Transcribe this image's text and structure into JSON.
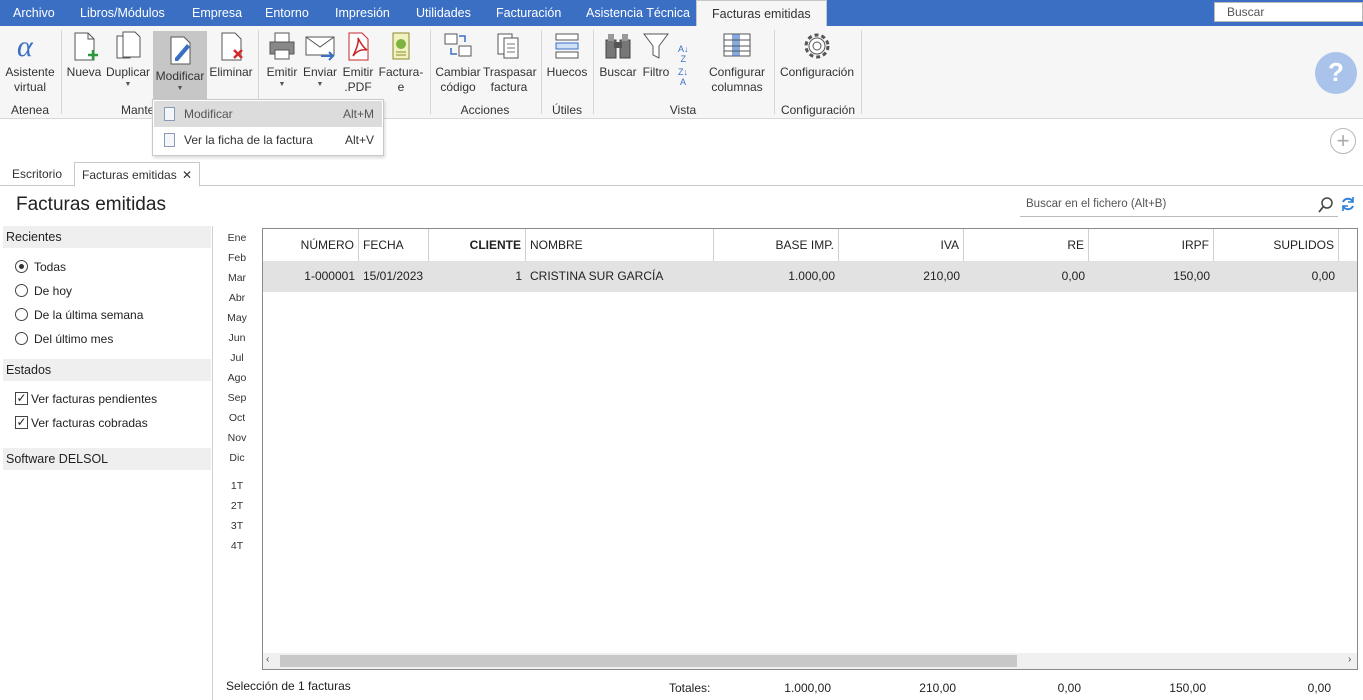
{
  "menubar": {
    "items": [
      "Archivo",
      "Libros/Módulos",
      "Empresa",
      "Entorno",
      "Impresión",
      "Utilidades",
      "Facturación",
      "Asistencia Técnica",
      "Facturas emitidas"
    ],
    "search_label": "Buscar"
  },
  "ribbon": {
    "buttons": {
      "asistente": "Asistente\nvirtual",
      "nueva": "Nueva",
      "duplicar": "Duplicar",
      "modificar": "Modificar",
      "eliminar": "Eliminar",
      "emitir": "Emitir",
      "enviar": "Enviar",
      "emitir_pdf": "Emitir\n.PDF",
      "factura_e": "Factura-\ne",
      "cambiar_codigo": "Cambiar\ncódigo",
      "traspasar": "Traspasar\nfactura",
      "huecos": "Huecos",
      "buscar": "Buscar",
      "filtro": "Filtro",
      "configurar_columnas": "Configurar\ncolumnas",
      "configuracion": "Configuración"
    },
    "groups": {
      "atenea": "Atenea",
      "mantenimiento": "Mante",
      "acciones": "Acciones",
      "utiles": "Útiles",
      "vista": "Vista",
      "configuracion": "Configuración"
    }
  },
  "dropdown": {
    "items": [
      {
        "label": "Modificar",
        "shortcut": "Alt+M"
      },
      {
        "label": "Ver la ficha de la factura",
        "shortcut": "Alt+V"
      }
    ]
  },
  "tabs": {
    "escritorio": "Escritorio",
    "facturas": "Facturas emitidas",
    "close": "✕"
  },
  "page": {
    "title": "Facturas emitidas",
    "search_placeholder": "Buscar en el fichero (Alt+B)"
  },
  "sidebar": {
    "recientes": "Recientes",
    "recientes_options": [
      "Todas",
      "De hoy",
      "De la última semana",
      "Del último mes"
    ],
    "estados": "Estados",
    "estados_options": [
      "Ver facturas pendientes",
      "Ver facturas cobradas"
    ],
    "software": "Software DELSOL"
  },
  "months": [
    "Ene",
    "Feb",
    "Mar",
    "Abr",
    "May",
    "Jun",
    "Jul",
    "Ago",
    "Sep",
    "Oct",
    "Nov",
    "Dic"
  ],
  "quarters": [
    "1T",
    "2T",
    "3T",
    "4T"
  ],
  "table": {
    "headers": [
      "NÚMERO",
      "FECHA",
      "CLIENTE",
      "NOMBRE",
      "BASE IMP.",
      "IVA",
      "RE",
      "IRPF",
      "SUPLIDOS"
    ],
    "rows": [
      [
        "1-000001",
        "15/01/2023",
        "1",
        "CRISTINA SUR GARCÍA",
        "1.000,00",
        "210,00",
        "0,00",
        "150,00",
        "0,00"
      ]
    ]
  },
  "footer": {
    "selection": "Selección de 1 facturas",
    "totals_label": "Totales:",
    "totals": [
      "1.000,00",
      "210,00",
      "0,00",
      "150,00",
      "0,00"
    ]
  }
}
